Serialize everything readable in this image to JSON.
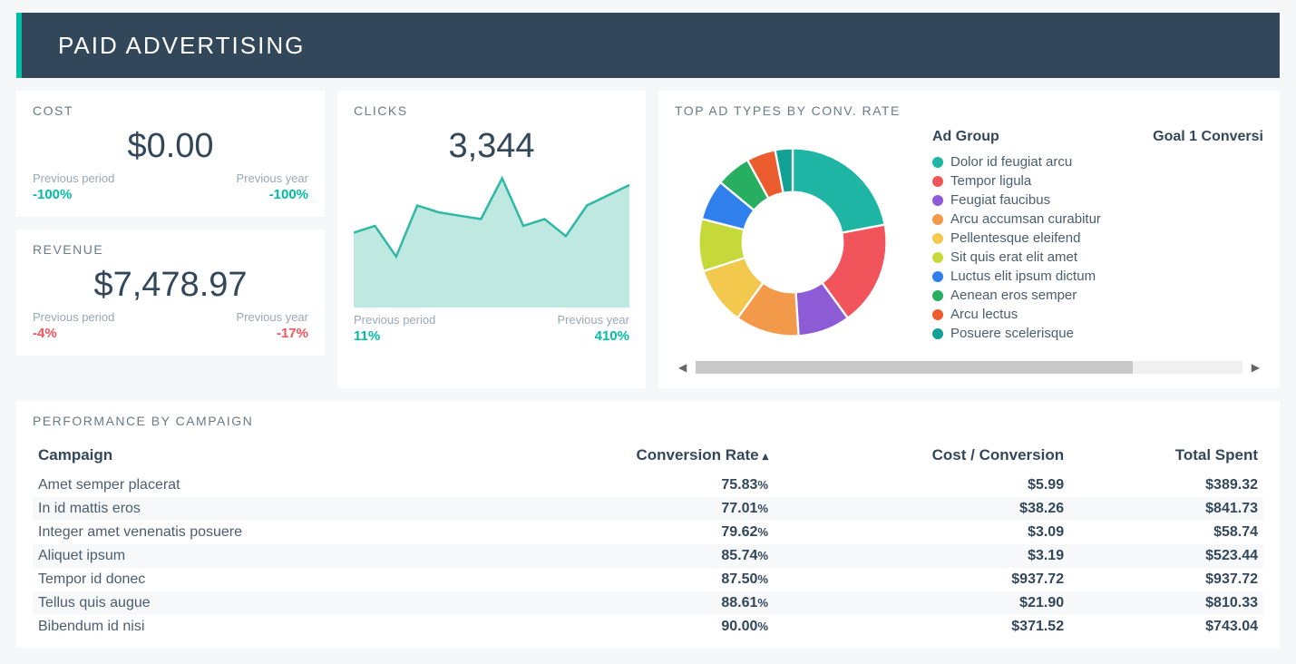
{
  "header": {
    "title": "PAID ADVERTISING"
  },
  "cost": {
    "label": "COST",
    "value": "$0.00",
    "prev_period_label": "Previous period",
    "prev_period_value": "-100%",
    "prev_year_label": "Previous year",
    "prev_year_value": "-100%"
  },
  "revenue": {
    "label": "REVENUE",
    "value": "$7,478.97",
    "prev_period_label": "Previous period",
    "prev_period_value": "-4%",
    "prev_year_label": "Previous year",
    "prev_year_value": "-17%"
  },
  "clicks": {
    "label": "CLICKS",
    "value": "3,344",
    "prev_period_label": "Previous period",
    "prev_period_value": "11%",
    "prev_year_label": "Previous year",
    "prev_year_value": "410%"
  },
  "adtypes": {
    "label": "TOP AD TYPES BY CONV. RATE",
    "col_group": "Ad Group",
    "col_metric": "Goal 1 Conversi",
    "items": [
      {
        "label": "Dolor id feugiat arcu",
        "color": "#1fb5a5",
        "value": 22
      },
      {
        "label": "Tempor ligula",
        "color": "#f2545b",
        "value": 18
      },
      {
        "label": "Feugiat faucibus",
        "color": "#8d5bd6",
        "value": 9
      },
      {
        "label": "Arcu accumsan curabitur",
        "color": "#f2994a",
        "value": 11
      },
      {
        "label": "Pellentesque eleifend",
        "color": "#f2c94c",
        "value": 10
      },
      {
        "label": "Sit quis erat elit amet",
        "color": "#c6d93b",
        "value": 9
      },
      {
        "label": "Luctus elit ipsum dictum",
        "color": "#2f80ed",
        "value": 7
      },
      {
        "label": "Aenean eros semper",
        "color": "#27ae60",
        "value": 6
      },
      {
        "label": "Arcu lectus",
        "color": "#eb5c2e",
        "value": 5
      },
      {
        "label": "Posuere scelerisque",
        "color": "#11a195",
        "value": 3
      }
    ]
  },
  "campaigns": {
    "label": "PERFORMANCE BY CAMPAIGN",
    "col_campaign": "Campaign",
    "col_conv": "Conversion Rate",
    "col_cpc": "Cost / Conversion",
    "col_spent": "Total Spent",
    "sort_icon": "▴",
    "rows": [
      {
        "name": "Amet semper placerat",
        "conv": "75.83",
        "cpc": "$5.99",
        "spent": "$389.32"
      },
      {
        "name": "In id mattis eros",
        "conv": "77.01",
        "cpc": "$38.26",
        "spent": "$841.73"
      },
      {
        "name": "Integer amet venenatis posuere",
        "conv": "79.62",
        "cpc": "$3.09",
        "spent": "$58.74"
      },
      {
        "name": "Aliquet ipsum",
        "conv": "85.74",
        "cpc": "$3.19",
        "spent": "$523.44"
      },
      {
        "name": "Tempor id donec",
        "conv": "87.50",
        "cpc": "$937.72",
        "spent": "$937.72"
      },
      {
        "name": "Tellus quis augue",
        "conv": "88.61",
        "cpc": "$21.90",
        "spent": "$810.33"
      },
      {
        "name": "Bibendum id nisi",
        "conv": "90.00",
        "cpc": "$371.52",
        "spent": "$743.04"
      }
    ]
  },
  "chart_data": [
    {
      "type": "area",
      "title": "CLICKS",
      "x": [
        0,
        1,
        2,
        3,
        4,
        5,
        6,
        7,
        8,
        9,
        10,
        11,
        12,
        13
      ],
      "values": [
        220,
        240,
        150,
        300,
        280,
        270,
        260,
        380,
        240,
        260,
        210,
        300,
        330,
        360
      ],
      "ylim": [
        0,
        400
      ]
    },
    {
      "type": "pie",
      "title": "TOP AD TYPES BY CONV. RATE",
      "categories": [
        "Dolor id feugiat arcu",
        "Tempor ligula",
        "Feugiat faucibus",
        "Arcu accumsan curabitur",
        "Pellentesque eleifend",
        "Sit quis erat elit amet",
        "Luctus elit ipsum dictum",
        "Aenean eros semper",
        "Arcu lectus",
        "Posuere scelerisque"
      ],
      "values": [
        22,
        18,
        9,
        11,
        10,
        9,
        7,
        6,
        5,
        3
      ]
    }
  ]
}
